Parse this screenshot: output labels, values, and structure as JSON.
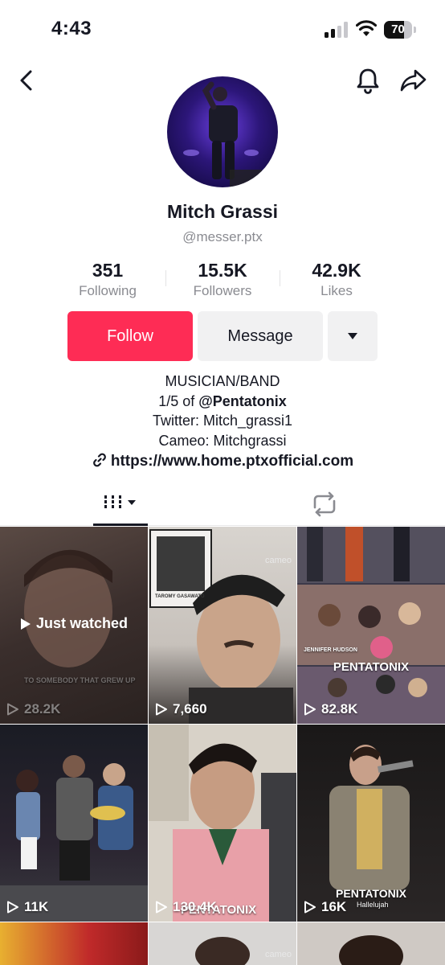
{
  "status_bar": {
    "time": "4:43",
    "battery": "70",
    "battery_level": 0.7
  },
  "nav": {
    "back_icon": "chevron-left-icon",
    "bell_icon": "bell-icon",
    "share_icon": "share-arrow-icon"
  },
  "profile": {
    "name": "Mitch Grassi",
    "handle": "@messer.ptx",
    "stats": [
      {
        "value": "351",
        "label": "Following"
      },
      {
        "value": "15.5K",
        "label": "Followers"
      },
      {
        "value": "42.9K",
        "label": "Likes"
      }
    ]
  },
  "actions": {
    "follow_label": "Follow",
    "message_label": "Message",
    "more_icon": "caret-down-icon"
  },
  "bio": {
    "line1": "MUSICIAN/BAND",
    "line2_prefix": "1/5 of ",
    "line2_mention": "@Pentatonix",
    "line3": "Twitter: Mitch_grassi1",
    "line4": "Cameo: Mitchgrassi",
    "link": "https://www.home.ptxofficial.com"
  },
  "tabs": {
    "videos_icon": "grid-icon",
    "reposts_icon": "repost-icon"
  },
  "colors": {
    "accent": "#fe2c55",
    "text": "#161823",
    "muted": "#8a8b91",
    "button_bg": "#f1f1f2"
  },
  "videos": [
    {
      "views": "28.2K",
      "badge": "Just watched",
      "caption": "TO SOMEBODY THAT GREW UP"
    },
    {
      "views": "7,660",
      "watermark": "cameo",
      "caption": "TAROMY GASAWATO"
    },
    {
      "views": "82.8K",
      "caption": "PENTATONIX",
      "caption2": "JENNIFER HUDSON"
    },
    {
      "views": "11K"
    },
    {
      "views": "130.4K",
      "caption": "PENTATONIX"
    },
    {
      "views": "16K",
      "caption": "PENTATONIX",
      "caption2": "Hallelujah"
    },
    {
      "views": ""
    },
    {
      "views": "",
      "watermark": "cameo"
    },
    {
      "views": ""
    }
  ]
}
